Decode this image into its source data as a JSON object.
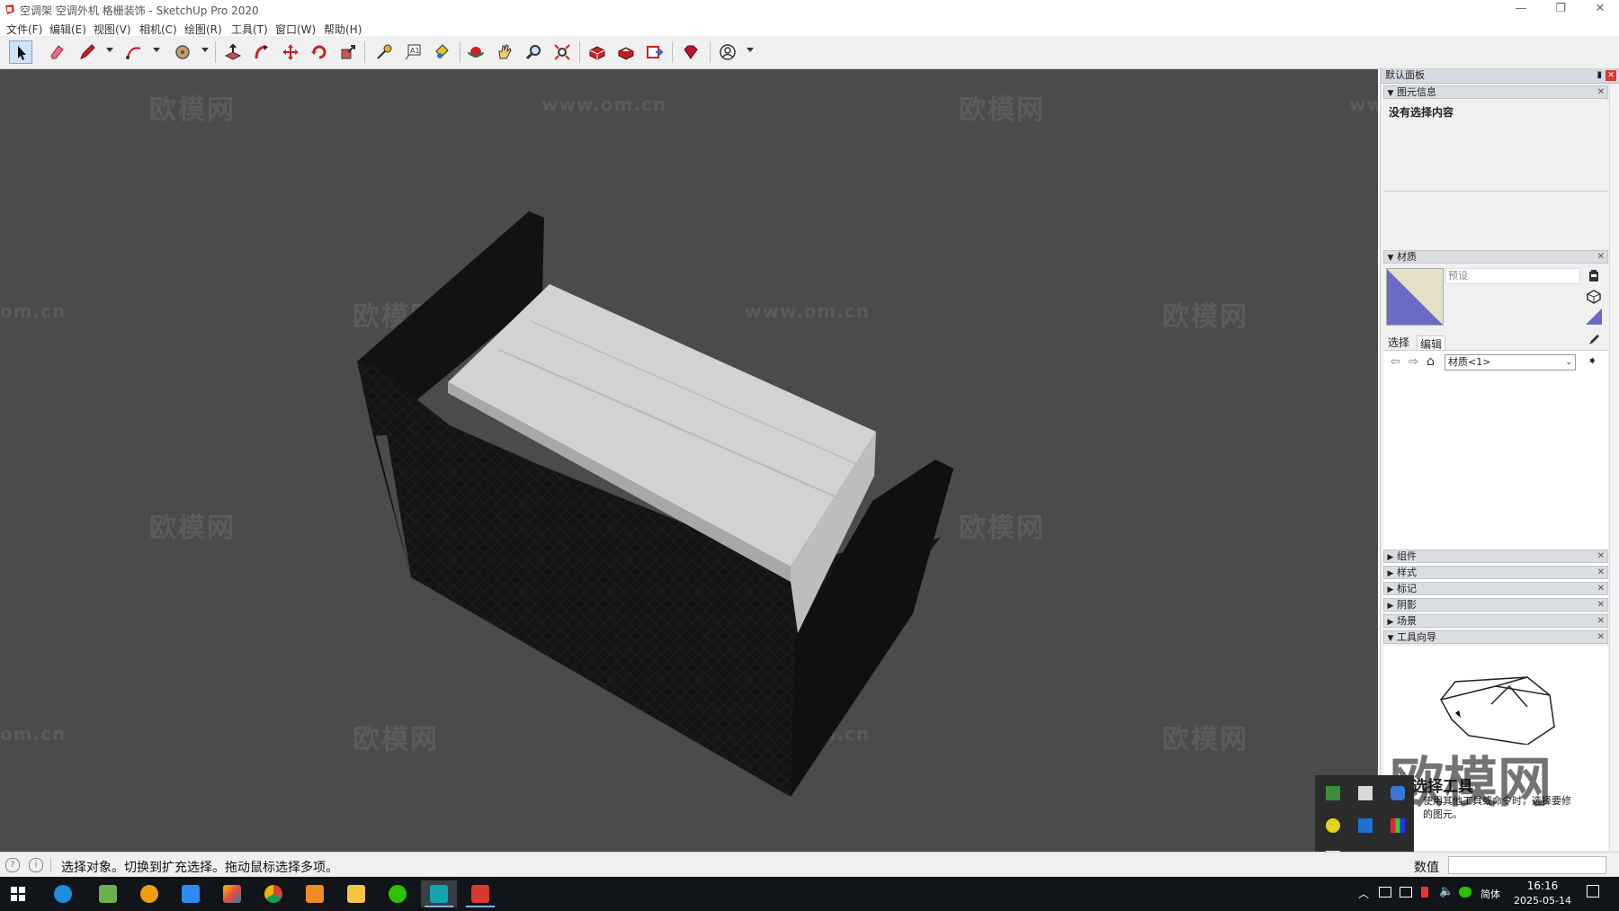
{
  "window": {
    "title": "空调架 空调外机 格栅装饰 - SketchUp Pro 2020",
    "controls": {
      "minimize": "—",
      "restore": "❐",
      "close": "✕"
    }
  },
  "menu": [
    "文件(F)",
    "编辑(E)",
    "视图(V)",
    "相机(C)",
    "绘图(R)",
    "工具(T)",
    "窗口(W)",
    "帮助(H)"
  ],
  "toolbar": {
    "tools": [
      "select-tool",
      "eraser-tool",
      "pencil-tool",
      "arc-tool",
      "circle-tool",
      "push-pull-tool",
      "follow-me-tool",
      "move-tool",
      "rotate-tool",
      "scale-tool",
      "tape-measure-tool",
      "text-tool",
      "paint-bucket-tool",
      "orbit-tool",
      "pan-tool",
      "zoom-tool",
      "zoom-extents-tool",
      "3d-warehouse-tool",
      "extension-warehouse-tool",
      "layout-send-tool",
      "ruby-extension-tool",
      "account-tool"
    ]
  },
  "viewport": {
    "watermarks": {
      "brand": "欧模网",
      "url": "www.om.cn",
      "partial": "om.cn"
    },
    "colors": {
      "background": "#4b4b4b",
      "frame": "#111111",
      "unit": "#d2d2d2"
    }
  },
  "panel": {
    "header": "默认面板",
    "entity_info": {
      "title": "图元信息",
      "content": "没有选择内容"
    },
    "materials": {
      "title": "材质",
      "preset_placeholder": "预设",
      "tabs": [
        "选择",
        "编辑"
      ],
      "dropdown_value": "材质<1>"
    },
    "collapsed_sections": [
      "组件",
      "样式",
      "标记",
      "阴影",
      "场景"
    ],
    "instructor": {
      "title": "工具向导",
      "heading": "选择工具",
      "desc_line1": "使用其他工具或命令时，选择要修",
      "desc_line2": "的图元。"
    }
  },
  "statusbar": {
    "message": "选择对象。切换到扩充选择。拖动鼠标选择多项。",
    "value_label": "数值"
  },
  "taskbar": {
    "ime": "简体",
    "time": "16:16",
    "date": "2025-05-14"
  }
}
